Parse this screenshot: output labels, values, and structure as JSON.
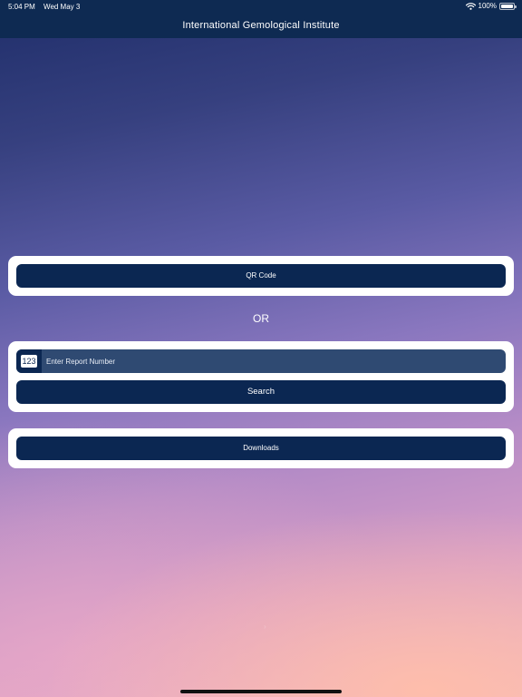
{
  "status_bar": {
    "time": "5:04 PM",
    "date": "Wed May 3",
    "battery": "100%",
    "battery_level": 1.0,
    "wifi_icon": "wifi-icon",
    "battery_icon": "battery-icon"
  },
  "nav": {
    "title": "International Gemological Institute"
  },
  "qr": {
    "button_label": "QR Code"
  },
  "divider": {
    "or_label": "OR"
  },
  "search": {
    "field_icon": "123",
    "placeholder": "Enter Report Number",
    "value": "",
    "button_label": "Search"
  },
  "downloads": {
    "button_label": "Downloads"
  },
  "colors": {
    "bar_background": "#0e2a52",
    "button_background": "#0b2752",
    "field_background": "#2f4a72",
    "card_background": "#ffffff",
    "gradient_top": "#1f2e6a",
    "gradient_mid": "#8a77bf",
    "gradient_bottom": "#f0b6c2"
  }
}
